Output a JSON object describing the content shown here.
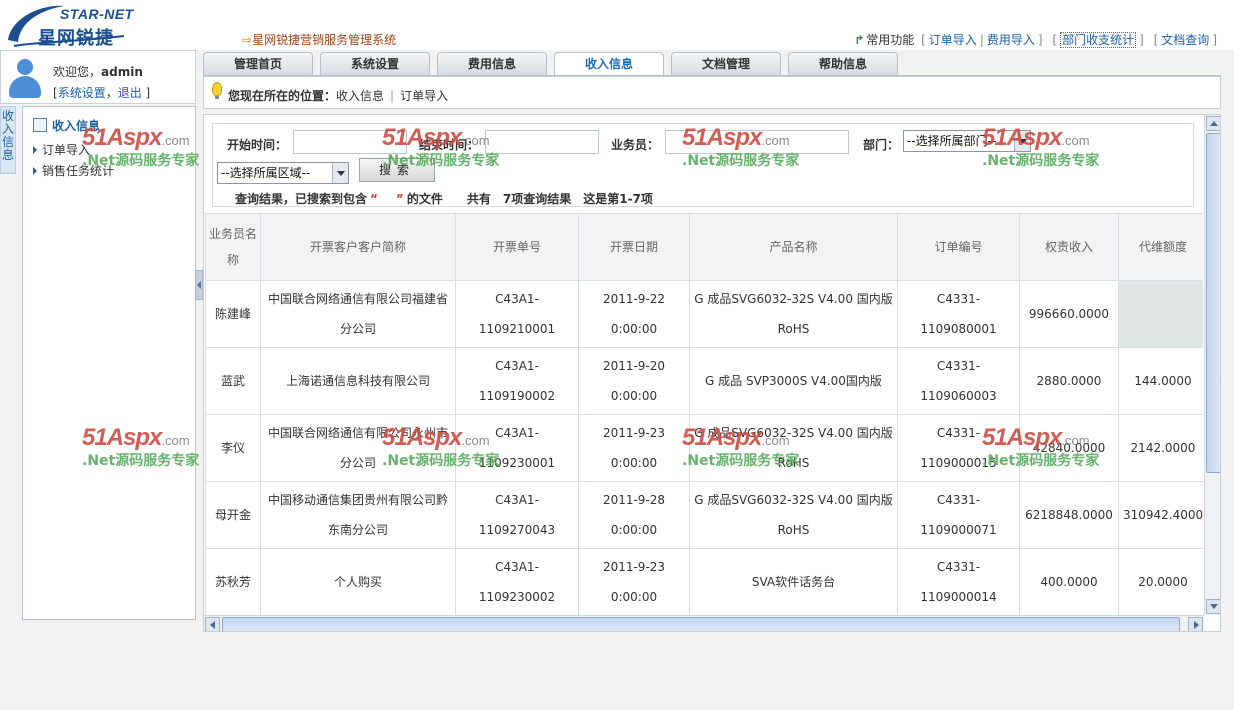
{
  "brand": {
    "logo_en": "STAR-NET",
    "logo_cn": "星网锐捷"
  },
  "header": {
    "system_title": "星网锐捷营销服务管理系统",
    "quick_label": "常用功能",
    "quick_links": [
      "订单导入",
      "费用导入",
      "部门收支统计",
      "文档查询"
    ]
  },
  "user": {
    "welcome_prefix": "欢迎您，",
    "name": "admin",
    "settings_link": "系统设置",
    "logout_link": "退出"
  },
  "vertical_tab": "收入信息",
  "sidebar": {
    "title": "收入信息",
    "items": [
      "订单导入",
      "销售任务统计"
    ]
  },
  "tabs": [
    "管理首页",
    "系统设置",
    "费用信息",
    "收入信息",
    "文档管理",
    "帮助信息"
  ],
  "location": {
    "label": "您现在所在的位置：",
    "path": [
      "收入信息",
      "订单导入"
    ]
  },
  "filter": {
    "start_label": "开始时间：",
    "end_label": "结束时间：",
    "salesman_label": "业务员：",
    "dept_label": "部门：",
    "dept_placeholder": "--选择所属部门--",
    "region_placeholder": "--选择所属区域--",
    "search_button": "搜索"
  },
  "result": {
    "prefix": "查询结果，已搜索到包含",
    "suffix": "的文件",
    "total": "共有　7项查询结果",
    "range": "这是第1-7项"
  },
  "table": {
    "headers": [
      "业务员名称",
      "开票客户客户简称",
      "开票单号",
      "开票日期",
      "产品名称",
      "订单编号",
      "权责收入",
      "代维额度"
    ],
    "rows": [
      [
        "陈建峰",
        "中国联合网络通信有限公司福建省分公司",
        "C43A1-1109210001",
        "2011-9-22 0:00:00",
        "G 成品SVG6032-32S V4.00 国内版 RoHS",
        "C4331-1109080001",
        "996660.0000",
        ""
      ],
      [
        "蓝武",
        "上海诺通信息科技有限公司",
        "C43A1-1109190002",
        "2011-9-20 0:00:00",
        "G 成品 SVP3000S V4.00国内版",
        "C4331-1109060003",
        "2880.0000",
        "144.0000"
      ],
      [
        "李仪",
        "中国联合网络通信有限公司永州市分公司",
        "C43A1-1109230001",
        "2011-9-23 0:00:00",
        "G 成品SVG6032-32S V4.00 国内版 RoHS",
        "C4331-1109000015",
        "42840.0000",
        "2142.0000"
      ],
      [
        "母开金",
        "中国移动通信集团贵州有限公司黔东南分公司",
        "C43A1-1109270043",
        "2011-9-28 0:00:00",
        "G 成品SVG6032-32S V4.00 国内版 RoHS",
        "C4331-1109000071",
        "6218848.0000",
        "310942.4000"
      ],
      [
        "苏秋芳",
        "个人购买",
        "C43A1-1109230002",
        "2011-9-23 0:00:00",
        "SVA软件话务台",
        "C4331-1109000014",
        "400.0000",
        "20.0000"
      ]
    ]
  },
  "watermark": {
    "main": "51Aspx",
    "domain": ".com",
    "tagline": ".Net源码服务专家"
  }
}
